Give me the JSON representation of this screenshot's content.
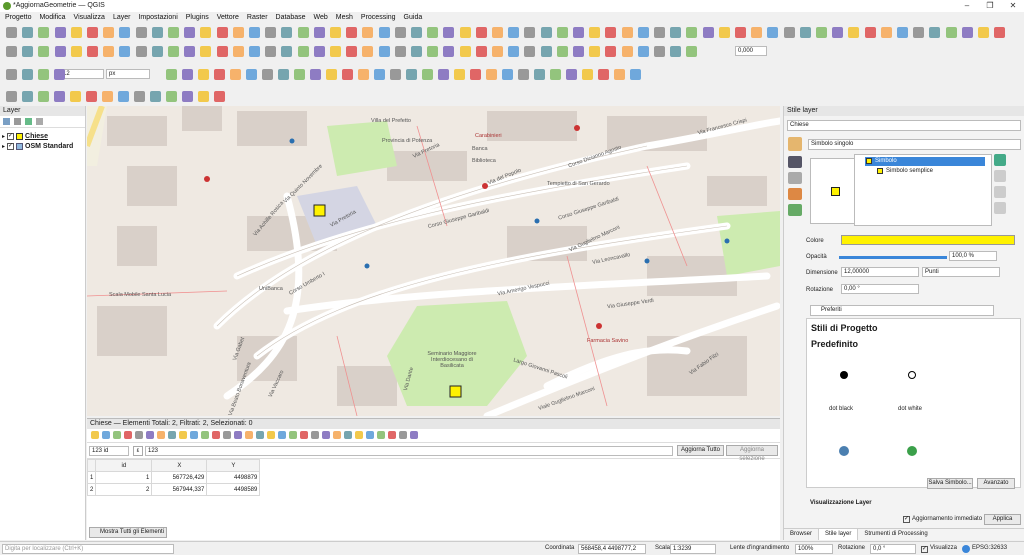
{
  "window": {
    "title": "*AggiornaGeometrie — QGIS"
  },
  "menu": [
    "Progetto",
    "Modifica",
    "Visualizza",
    "Layer",
    "Impostazioni",
    "Plugins",
    "Vettore",
    "Raster",
    "Database",
    "Web",
    "Mesh",
    "Processing",
    "Guida"
  ],
  "toolbar": {
    "font_size": "12",
    "font_unit": "px",
    "scale_value": "0,000"
  },
  "layers_panel": {
    "title": "Layer",
    "items": [
      {
        "name": "Chiese",
        "checked": true
      },
      {
        "name": "OSM Standard",
        "checked": true
      }
    ]
  },
  "map": {
    "labels": [
      "Villa del Prefetto",
      "Provincia di Potenza",
      "Via Pretoria",
      "Via del Popolo",
      "Corso Giuseppe Garibaldi",
      "Corso Umberto I",
      "Via Achille Rosica",
      "Via Quinto Novembre",
      "Via Pretoria",
      "Via Amerigo Vespucci",
      "Via Giuseppe Verdi",
      "Via Leoncavallo",
      "Via Guglielmo Marconi",
      "Via Francesco Crispi",
      "Corso Dicianno Agosto",
      "Largo Giovanni Pascoli",
      "Viale Guglielmo Marconi",
      "Via Fabio Filzi",
      "Via Vaccaro",
      "Via Beato Bonaventura",
      "Scala Mobile Santa Lucia",
      "Seminario Maggiore Interdiocesano di Basilicata",
      "Carabinieri",
      "Farmacia Savino",
      "Banca",
      "Tempietto di San Gerardo",
      "Biblioteca",
      "UniBanca",
      "Via Gabet",
      "Via Dante",
      "Corso Giuseppe Garibaldi"
    ]
  },
  "attribute_table": {
    "title": "Chiese — Elementi Totali: 2, Filtrati: 2, Selezionati: 0",
    "field_name": "123 id",
    "expression": "123",
    "update_all_btn": "Aggiorna Tutto",
    "update_selection_btn": "Aggiorna selezione",
    "columns": [
      "id",
      "X",
      "Y"
    ],
    "rows": [
      {
        "rownum": "1",
        "id": "1",
        "x": "567726,429",
        "y": "4498879"
      },
      {
        "rownum": "2",
        "id": "2",
        "x": "567944,337",
        "y": "4498589"
      }
    ],
    "show_all_btn": "Mostra Tutti gli Elementi"
  },
  "style_panel": {
    "title": "Stile layer",
    "layer": "Chiese",
    "renderer": "Simbolo singolo",
    "tree": [
      "Simbolo",
      "Simbolo semplice"
    ],
    "color_label": "Colore",
    "color": "#fff200",
    "opacity_label": "Opacità",
    "opacity": "100,0 %",
    "size_label": "Dimensione",
    "size": "12,00000",
    "size_unit": "Punti",
    "rotation_label": "Rotazione",
    "rotation": "0,00 °",
    "search": "Preferiti",
    "section1": "Stili di Progetto",
    "section2": "Predefinito",
    "symbols": [
      "dot black",
      "dot white"
    ],
    "save_symbol_btn": "Salva Simbolo...",
    "advanced_btn": "Avanzato",
    "live_render": "Visualizzazione Layer",
    "live_update": "Aggiornamento immediato",
    "apply_btn": "Applica",
    "tabs": [
      "Browser",
      "Stile layer",
      "Strumenti di Processing"
    ]
  },
  "statusbar": {
    "locator_placeholder": "Digita per localizzare (Ctrl+K)",
    "coord_label": "Coordinata",
    "coord": "568458,4 4498777,2",
    "scale_label": "Scala",
    "scale": "1:3239",
    "magnifier_label": "Lente d'ingrandimento",
    "magnifier": "100%",
    "rotation_label": "Rotazione",
    "rotation": "0,0 °",
    "render_label": "Visualizza",
    "crs": "EPSG:32633"
  }
}
